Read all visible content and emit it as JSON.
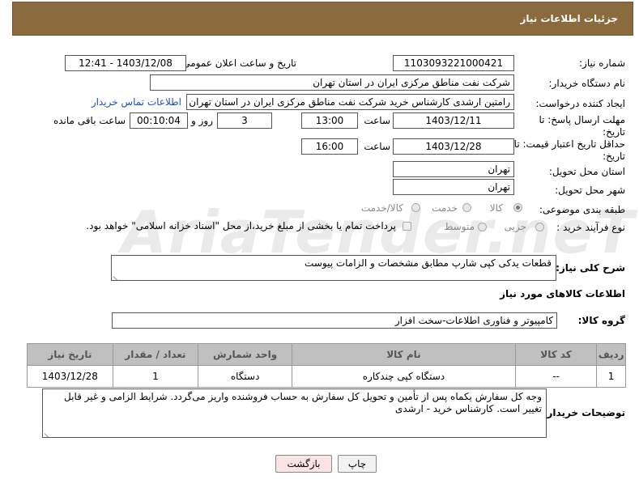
{
  "header": {
    "title": "جزئیات اطلاعات نیاز"
  },
  "fields": {
    "need_number_label": "شماره نیاز:",
    "need_number": "1103093221000421",
    "announce_label": "تاریخ و ساعت اعلان عمومی:",
    "announce_value": "1403/12/08 - 12:41",
    "buyer_org_label": "نام دستگاه خریدار:",
    "buyer_org": "شرکت نفت مناطق مرکزی ایران در استان تهران",
    "requester_label": "ایجاد کننده درخواست:",
    "requester": "رامتین ارشدی کارشناس خرید شرکت نفت مناطق مرکزی ایران در استان تهران",
    "contact_link": "اطلاعات تماس خریدار",
    "deadline_label_1": "مهلت ارسال پاسخ: تا",
    "deadline_label_2": "تاریخ:",
    "deadline_date": "1403/12/11",
    "time_label": "ساعت",
    "deadline_time": "13:00",
    "days_value": "3",
    "days_label": "روز و",
    "remaining_value": "00:10:04",
    "remaining_label": "ساعت باقی مانده",
    "validity_label_1": "حداقل تاریخ اعتبار قیمت: تا",
    "validity_label_2": "تاریخ:",
    "validity_date": "1403/12/28",
    "validity_time": "16:00",
    "province_label": "استان محل تحویل:",
    "province": "تهران",
    "city_label": "شهر محل تحویل:",
    "city": "تهران",
    "category_label": "طبقه بندی موضوعی:",
    "category_goods": "کالا",
    "category_service": "خدمت",
    "category_both": "کالا/خدمت",
    "process_label": "نوع فرآیند خرید :",
    "process_partial": "جزیی",
    "process_medium": "متوسط",
    "payment_note": "پرداخت تمام یا بخشی از مبلغ خرید،از محل \"اسناد خزانه اسلامی\" خواهد بود."
  },
  "description": {
    "label": "شرح کلی نیاز:",
    "text": "قطعات یدکی کپی شارپ مطابق مشخصات و الزامات پیوست"
  },
  "goods_section": {
    "title": "اطلاعات کالاهای مورد نیاز",
    "group_label": "گروه کالا:",
    "group_value": "کامپیوتر و فناوری اطلاعات-سخت افزار"
  },
  "table": {
    "headers": [
      "ردیف",
      "کد کالا",
      "نام کالا",
      "واحد شمارش",
      "تعداد / مقدار",
      "تاریخ نیاز"
    ],
    "rows": [
      [
        "1",
        "--",
        "دستگاه کپی چندکاره",
        "دستگاه",
        "1",
        "1403/12/28"
      ]
    ]
  },
  "buyer_notes": {
    "label": "توضیحات خریدار:",
    "text": "وجه کل سفارش یکماه پس از تأمین و تحویل کل سفارش به حساب فروشنده واریز می‌گردد. شرایط الزامی و غیر قابل تغییر است. کارشناس خرید - ارشدی"
  },
  "buttons": {
    "print": "چاپ",
    "back": "بازگشت"
  },
  "watermark": "AriaTender.neT",
  "colors": {
    "header_bg": "#8b6b3d",
    "table_header_bg": "#c0c0c0",
    "back_button_bg": "#fbe3e3",
    "print_button_bg": "#f2f2f2"
  }
}
